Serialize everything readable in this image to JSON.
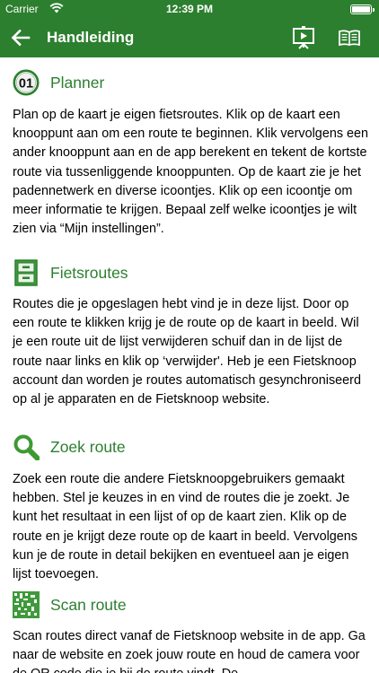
{
  "status_bar": {
    "carrier": "Carrier",
    "time": "12:39 PM"
  },
  "nav": {
    "title": "Handleiding",
    "back_icon": "arrow-left-icon",
    "present_icon": "presentation-icon",
    "book_icon": "book-open-icon"
  },
  "theme": {
    "accent": "#2c7f2f",
    "text": "#000000"
  },
  "sections": [
    {
      "icon": "numbered-01-icon",
      "icon_text": "01",
      "title": "Planner",
      "body": "Plan op de kaart je eigen fietsroutes. Klik op de kaart een knooppunt aan om een route te beginnen. Klik vervolgens een ander knooppunt aan en de app berekent en tekent de kortste route via tussenliggende knooppunten. Op de kaart zie je het padennetwerk en diverse icoontjes. Klik op een icoontje om meer informatie te krijgen. Bepaal zelf welke icoontjes je wilt zien via “Mijn instellingen”."
    },
    {
      "icon": "cabinet-icon",
      "title": "Fietsroutes",
      "body": "Routes die je opgeslagen hebt vind je in deze lijst. Door op een route te klikken krijg je de route op de kaart in beeld. Wil je een route uit de lijst verwijderen schuif dan in de lijst de route naar links en klik op ‘verwijder'. Heb je een Fietsknoop account dan worden je routes automatisch gesynchroniseerd op al je apparaten en de Fietsknoop website."
    },
    {
      "icon": "magnifier-icon",
      "title": "Zoek route",
      "body": "Zoek een route die andere Fietsknoopgebruikers gemaakt hebben. Stel je keuzes in en vind de routes die je zoekt. Je kunt het resultaat in een lijst of op de kaart zien. Klik op de route en je krijgt deze route op de kaart in beeld. Vervolgens kun je de route in detail bekijken en eventueel aan je eigen lijst toevoegen."
    },
    {
      "icon": "qr-code-icon",
      "title": "Scan route",
      "body": "Scan routes direct vanaf de Fietsknoop website in de app. Ga naar de website en zoek jouw route en houd de camera voor de QR code die je bij de route vindt. De"
    }
  ]
}
